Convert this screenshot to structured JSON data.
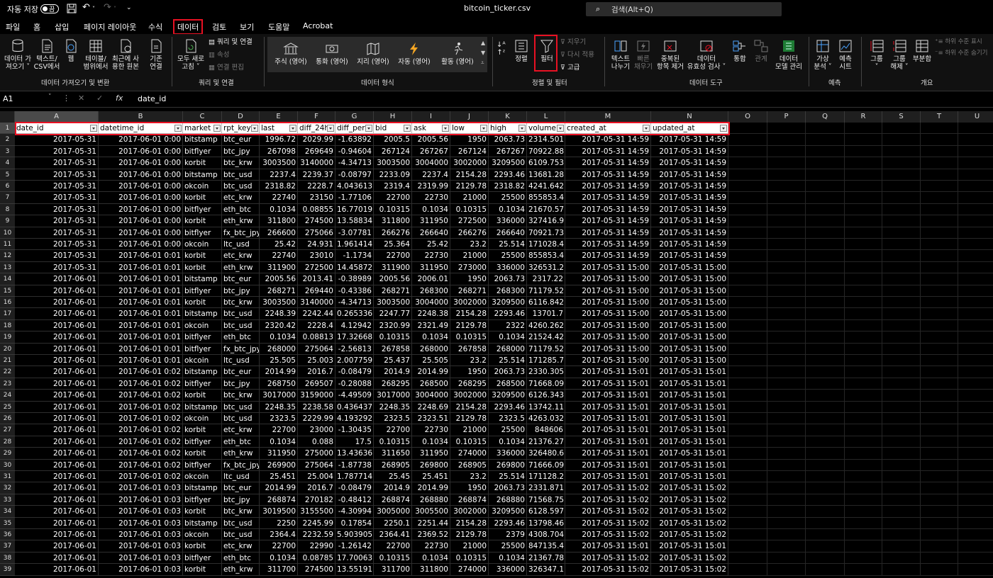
{
  "titlebar": {
    "autosave_label": "자동 저장",
    "toggle_state": "끔",
    "filename": "bitcoin_ticker.csv",
    "search_placeholder": "검색(Alt+Q)"
  },
  "tabs": [
    "파일",
    "홈",
    "삽입",
    "페이지 레이아웃",
    "수식",
    "데이터",
    "검토",
    "보기",
    "도움말",
    "Acrobat"
  ],
  "active_tab": "데이터",
  "ribbon": {
    "get_data": {
      "buttons": [
        "데이터 가\n져오기 ˅",
        "텍스트/\nCSV에서",
        "웹",
        "테이블/\n범위에서",
        "최근에 사\n용한 원본",
        "기존\n연결"
      ],
      "label": "데이터 가져오기 및 변환"
    },
    "queries": {
      "refresh_all": "모두 새로\n고침 ˅",
      "items": [
        "쿼리 및 연결",
        "속성",
        "연결 편집"
      ],
      "label": "쿼리 및 연결"
    },
    "data_types": {
      "buttons": [
        "주식 (영어)",
        "통화 (영어)",
        "지리 (영어)",
        "자동 (영어)",
        "활동 (영어)"
      ],
      "label": "데이터 형식"
    },
    "sort_filter": {
      "sort": "정렬",
      "filter": "필터",
      "small": [
        "지우기",
        "다시 적용",
        "고급"
      ],
      "label": "정렬 및 필터"
    },
    "data_tools": {
      "buttons": [
        "텍스트\n나누기",
        "빠른\n채우기",
        "중복된\n항목 제거",
        "데이터\n유효성 검사 ˅",
        "통합",
        "관계",
        "데이터\n모델 관리"
      ],
      "label": "데이터 도구"
    },
    "forecast": {
      "buttons": [
        "가상\n분석 ˅",
        "예측\n시트"
      ],
      "label": "예측"
    },
    "outline": {
      "buttons": [
        "그룹\n˅",
        "그룹\n해제 ˅",
        "부분합"
      ],
      "small": [
        "하위 수준 표시",
        "하위 수준 숨기기"
      ],
      "label": "개요"
    }
  },
  "formula_bar": {
    "name_box": "A1",
    "fx": "fx",
    "value": "date_id"
  },
  "columns": [
    "A",
    "B",
    "C",
    "D",
    "E",
    "F",
    "G",
    "H",
    "I",
    "J",
    "K",
    "L",
    "M",
    "N",
    "O",
    "P",
    "Q",
    "R",
    "S",
    "T",
    "U"
  ],
  "headers": [
    "date_id",
    "datetime_id",
    "market",
    "rpt_key",
    "last",
    "diff_24h",
    "diff_per",
    "bid",
    "ask",
    "low",
    "high",
    "volume",
    "created_at",
    "updated_at"
  ],
  "rows": [
    [
      "2017-05-31",
      "2017-06-01 0:00",
      "bitstamp",
      "btc_eur",
      "1996.72",
      "2029.99",
      "-1.63892",
      "2005.5",
      "2005.56",
      "1950",
      "2063.73",
      "2314.501",
      "2017-05-31 14:59",
      "2017-05-31 14:59"
    ],
    [
      "2017-05-31",
      "2017-06-01 0:00",
      "bitflyer",
      "btc_jpy",
      "267098",
      "269649",
      "-0.94604",
      "267124",
      "267267",
      "267124",
      "267267",
      "70922.88",
      "2017-05-31 14:59",
      "2017-05-31 14:59"
    ],
    [
      "2017-05-31",
      "2017-06-01 0:00",
      "korbit",
      "btc_krw",
      "3003500",
      "3140000",
      "-4.34713",
      "3003500",
      "3004000",
      "3002000",
      "3209500",
      "6109.753",
      "2017-05-31 14:59",
      "2017-05-31 14:59"
    ],
    [
      "2017-05-31",
      "2017-06-01 0:00",
      "bitstamp",
      "btc_usd",
      "2237.4",
      "2239.37",
      "-0.08797",
      "2233.09",
      "2237.4",
      "2154.28",
      "2293.46",
      "13681.28",
      "2017-05-31 14:59",
      "2017-05-31 14:59"
    ],
    [
      "2017-05-31",
      "2017-06-01 0:00",
      "okcoin",
      "btc_usd",
      "2318.82",
      "2228.7",
      "4.043613",
      "2319.4",
      "2319.99",
      "2129.78",
      "2318.82",
      "4241.642",
      "2017-05-31 14:59",
      "2017-05-31 14:59"
    ],
    [
      "2017-05-31",
      "2017-06-01 0:00",
      "korbit",
      "etc_krw",
      "22740",
      "23150",
      "-1.77106",
      "22700",
      "22730",
      "21000",
      "25500",
      "855853.4",
      "2017-05-31 14:59",
      "2017-05-31 14:59"
    ],
    [
      "2017-05-31",
      "2017-06-01 0:00",
      "bitflyer",
      "eth_btc",
      "0.1034",
      "0.08855",
      "16.77019",
      "0.10315",
      "0.1034",
      "0.10315",
      "0.1034",
      "21670.57",
      "2017-05-31 14:59",
      "2017-05-31 14:59"
    ],
    [
      "2017-05-31",
      "2017-06-01 0:00",
      "korbit",
      "eth_krw",
      "311800",
      "274500",
      "13.58834",
      "311800",
      "311950",
      "272500",
      "336000",
      "327416.9",
      "2017-05-31 14:59",
      "2017-05-31 14:59"
    ],
    [
      "2017-05-31",
      "2017-06-01 0:00",
      "bitflyer",
      "fx_btc_jpy",
      "266600",
      "275066",
      "-3.07781",
      "266276",
      "266640",
      "266276",
      "266640",
      "70921.73",
      "2017-05-31 14:59",
      "2017-05-31 14:59"
    ],
    [
      "2017-05-31",
      "2017-06-01 0:00",
      "okcoin",
      "ltc_usd",
      "25.42",
      "24.931",
      "1.961414",
      "25.364",
      "25.42",
      "23.2",
      "25.514",
      "171028.4",
      "2017-05-31 14:59",
      "2017-05-31 14:59"
    ],
    [
      "2017-05-31",
      "2017-06-01 0:01",
      "korbit",
      "etc_krw",
      "22740",
      "23010",
      "-1.1734",
      "22700",
      "22730",
      "21000",
      "25500",
      "855853.4",
      "2017-05-31 14:59",
      "2017-05-31 14:59"
    ],
    [
      "2017-05-31",
      "2017-06-01 0:01",
      "korbit",
      "eth_krw",
      "311900",
      "272500",
      "14.45872",
      "311900",
      "311950",
      "273000",
      "336000",
      "326531.2",
      "2017-05-31 15:00",
      "2017-05-31 15:00"
    ],
    [
      "2017-06-01",
      "2017-06-01 0:01",
      "bitstamp",
      "btc_eur",
      "2005.56",
      "2013.41",
      "-0.38989",
      "2005.56",
      "2006.01",
      "1950",
      "2063.73",
      "2317.22",
      "2017-05-31 15:00",
      "2017-05-31 15:00"
    ],
    [
      "2017-06-01",
      "2017-06-01 0:01",
      "bitflyer",
      "btc_jpy",
      "268271",
      "269440",
      "-0.43386",
      "268271",
      "268300",
      "268271",
      "268300",
      "71179.52",
      "2017-05-31 15:00",
      "2017-05-31 15:00"
    ],
    [
      "2017-06-01",
      "2017-06-01 0:01",
      "korbit",
      "btc_krw",
      "3003500",
      "3140000",
      "-4.34713",
      "3003500",
      "3004000",
      "3002000",
      "3209500",
      "6116.842",
      "2017-05-31 15:00",
      "2017-05-31 15:00"
    ],
    [
      "2017-06-01",
      "2017-06-01 0:01",
      "bitstamp",
      "btc_usd",
      "2248.39",
      "2242.44",
      "0.265336",
      "2247.77",
      "2248.38",
      "2154.28",
      "2293.46",
      "13701.7",
      "2017-05-31 15:00",
      "2017-05-31 15:00"
    ],
    [
      "2017-06-01",
      "2017-06-01 0:01",
      "okcoin",
      "btc_usd",
      "2320.42",
      "2228.4",
      "4.12942",
      "2320.99",
      "2321.49",
      "2129.78",
      "2322",
      "4260.262",
      "2017-05-31 15:00",
      "2017-05-31 15:00"
    ],
    [
      "2017-06-01",
      "2017-06-01 0:01",
      "bitflyer",
      "eth_btc",
      "0.1034",
      "0.08813",
      "17.32668",
      "0.10315",
      "0.1034",
      "0.10315",
      "0.1034",
      "21524.42",
      "2017-05-31 15:00",
      "2017-05-31 15:00"
    ],
    [
      "2017-06-01",
      "2017-06-01 0:01",
      "bitflyer",
      "fx_btc_jpy",
      "268000",
      "275064",
      "-2.56813",
      "267858",
      "268000",
      "267858",
      "268000",
      "71179.52",
      "2017-05-31 15:00",
      "2017-05-31 15:00"
    ],
    [
      "2017-06-01",
      "2017-06-01 0:01",
      "okcoin",
      "ltc_usd",
      "25.505",
      "25.003",
      "2.007759",
      "25.437",
      "25.505",
      "23.2",
      "25.514",
      "171285.7",
      "2017-05-31 15:00",
      "2017-05-31 15:00"
    ],
    [
      "2017-06-01",
      "2017-06-01 0:02",
      "bitstamp",
      "btc_eur",
      "2014.99",
      "2016.7",
      "-0.08479",
      "2014.9",
      "2014.99",
      "1950",
      "2063.73",
      "2330.305",
      "2017-05-31 15:01",
      "2017-05-31 15:01"
    ],
    [
      "2017-06-01",
      "2017-06-01 0:02",
      "bitflyer",
      "btc_jpy",
      "268750",
      "269507",
      "-0.28088",
      "268295",
      "268500",
      "268295",
      "268500",
      "71668.09",
      "2017-05-31 15:01",
      "2017-05-31 15:01"
    ],
    [
      "2017-06-01",
      "2017-06-01 0:02",
      "korbit",
      "btc_krw",
      "3017000",
      "3159000",
      "-4.49509",
      "3017000",
      "3004000",
      "3002000",
      "3209500",
      "6126.343",
      "2017-05-31 15:01",
      "2017-05-31 15:01"
    ],
    [
      "2017-06-01",
      "2017-06-01 0:02",
      "bitstamp",
      "btc_usd",
      "2248.35",
      "2238.58",
      "0.436437",
      "2248.35",
      "2248.69",
      "2154.28",
      "2293.46",
      "13742.11",
      "2017-05-31 15:01",
      "2017-05-31 15:01"
    ],
    [
      "2017-06-01",
      "2017-06-01 0:02",
      "okcoin",
      "btc_usd",
      "2323.5",
      "2229.99",
      "4.193292",
      "2323.5",
      "2323.51",
      "2129.78",
      "2323.5",
      "4263.032",
      "2017-05-31 15:01",
      "2017-05-31 15:01"
    ],
    [
      "2017-06-01",
      "2017-06-01 0:02",
      "korbit",
      "etc_krw",
      "22700",
      "23000",
      "-1.30435",
      "22700",
      "22730",
      "21000",
      "25500",
      "848606",
      "2017-05-31 15:01",
      "2017-05-31 15:01"
    ],
    [
      "2017-06-01",
      "2017-06-01 0:02",
      "bitflyer",
      "eth_btc",
      "0.1034",
      "0.088",
      "17.5",
      "0.10315",
      "0.1034",
      "0.10315",
      "0.1034",
      "21376.27",
      "2017-05-31 15:01",
      "2017-05-31 15:01"
    ],
    [
      "2017-06-01",
      "2017-06-01 0:02",
      "korbit",
      "eth_krw",
      "311950",
      "275000",
      "13.43636",
      "311650",
      "311950",
      "274000",
      "336000",
      "326480.6",
      "2017-05-31 15:01",
      "2017-05-31 15:01"
    ],
    [
      "2017-06-01",
      "2017-06-01 0:02",
      "bitflyer",
      "fx_btc_jpy",
      "269900",
      "275064",
      "-1.87738",
      "268905",
      "269800",
      "268905",
      "269800",
      "71666.09",
      "2017-05-31 15:01",
      "2017-05-31 15:01"
    ],
    [
      "2017-06-01",
      "2017-06-01 0:02",
      "okcoin",
      "ltc_usd",
      "25.451",
      "25.004",
      "1.787714",
      "25.45",
      "25.451",
      "23.2",
      "25.514",
      "171128.2",
      "2017-05-31 15:01",
      "2017-05-31 15:01"
    ],
    [
      "2017-06-01",
      "2017-06-01 0:03",
      "bitstamp",
      "btc_eur",
      "2014.99",
      "2016.7",
      "-0.08479",
      "2014.9",
      "2014.99",
      "1950",
      "2063.73",
      "2331.871",
      "2017-05-31 15:02",
      "2017-05-31 15:02"
    ],
    [
      "2017-06-01",
      "2017-06-01 0:03",
      "bitflyer",
      "btc_jpy",
      "268874",
      "270182",
      "-0.48412",
      "268874",
      "268880",
      "268874",
      "268880",
      "71568.75",
      "2017-05-31 15:02",
      "2017-05-31 15:02"
    ],
    [
      "2017-06-01",
      "2017-06-01 0:03",
      "korbit",
      "btc_krw",
      "3019500",
      "3155500",
      "-4.30994",
      "3005000",
      "3005500",
      "3002000",
      "3209500",
      "6128.597",
      "2017-05-31 15:02",
      "2017-05-31 15:02"
    ],
    [
      "2017-06-01",
      "2017-06-01 0:03",
      "bitstamp",
      "btc_usd",
      "2250",
      "2245.99",
      "0.17854",
      "2250.1",
      "2251.44",
      "2154.28",
      "2293.46",
      "13798.46",
      "2017-05-31 15:02",
      "2017-05-31 15:02"
    ],
    [
      "2017-06-01",
      "2017-06-01 0:03",
      "okcoin",
      "btc_usd",
      "2364.4",
      "2232.59",
      "5.903905",
      "2364.41",
      "2369.52",
      "2129.78",
      "2379",
      "4308.704",
      "2017-05-31 15:02",
      "2017-05-31 15:02"
    ],
    [
      "2017-06-01",
      "2017-06-01 0:03",
      "korbit",
      "etc_krw",
      "22700",
      "22990",
      "-1.26142",
      "22700",
      "22730",
      "21000",
      "25500",
      "847135.4",
      "2017-05-31 15:01",
      "2017-05-31 15:01"
    ],
    [
      "2017-06-01",
      "2017-06-01 0:03",
      "bitflyer",
      "eth_btc",
      "0.1034",
      "0.08785",
      "17.70063",
      "0.10315",
      "0.1034",
      "0.10315",
      "0.1034",
      "21367.78",
      "2017-05-31 15:02",
      "2017-05-31 15:02"
    ],
    [
      "2017-06-01",
      "2017-06-01 0:03",
      "korbit",
      "eth_krw",
      "311700",
      "274500",
      "13.55191",
      "311700",
      "311800",
      "274000",
      "336000",
      "326347.1",
      "2017-05-31 15:02",
      "2017-05-31 15:02"
    ]
  ],
  "colors": {
    "accent_red": "#e81123",
    "header_fill": "#ffffff",
    "grid_bg": "#000000"
  }
}
